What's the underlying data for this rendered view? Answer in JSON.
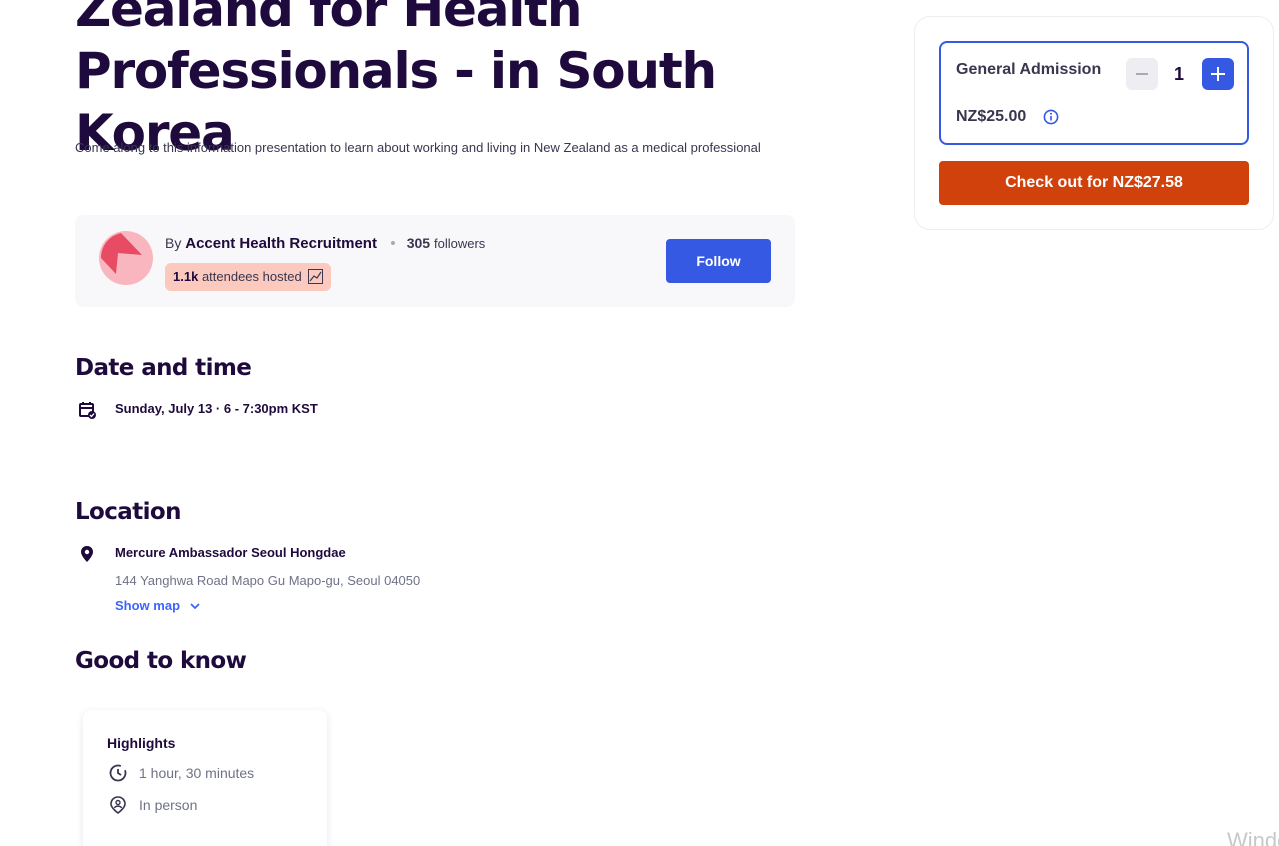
{
  "event": {
    "title": "Zealand for Health Professionals - in South Korea",
    "summary": "Come along to this information presentation to learn about working and living in New Zealand as a medical professional"
  },
  "organizer": {
    "by_prefix": "By",
    "name": "Accent Health Recruitment",
    "followers_count": "305",
    "followers_label": "followers",
    "attendees_count": "1.1k",
    "attendees_label": "attendees hosted",
    "follow_label": "Follow",
    "avatar_colors": {
      "bg": "#f9b6be",
      "fg": "#e84c64"
    }
  },
  "date_time": {
    "heading": "Date and time",
    "text": "Sunday, July 13 · 6 - 7:30pm KST",
    "icon": "calendar-check-icon"
  },
  "location": {
    "heading": "Location",
    "venue": "Mercure Ambassador Seoul Hongdae",
    "address": "144 Yanghwa Road Mapo Gu Mapo-gu, Seoul 04050",
    "show_map_label": "Show map",
    "icon": "map-pin-icon"
  },
  "good_to_know": {
    "heading": "Good to know",
    "highlights_title": "Highlights",
    "items": [
      {
        "icon": "clock-icon",
        "label": "1 hour, 30 minutes"
      },
      {
        "icon": "person-pin-icon",
        "label": "In person"
      }
    ]
  },
  "ticket": {
    "name": "General Admission",
    "price": "NZ$25.00",
    "quantity": "1",
    "checkout_label": "Check out for NZ$27.58"
  },
  "os": {
    "watermark": "Windo"
  },
  "colors": {
    "brand_blue": "#3659e3",
    "checkout_orange": "#d1410c",
    "heading": "#1e0a3c",
    "badge": "#fbc9be",
    "link": "#3d64ff"
  }
}
